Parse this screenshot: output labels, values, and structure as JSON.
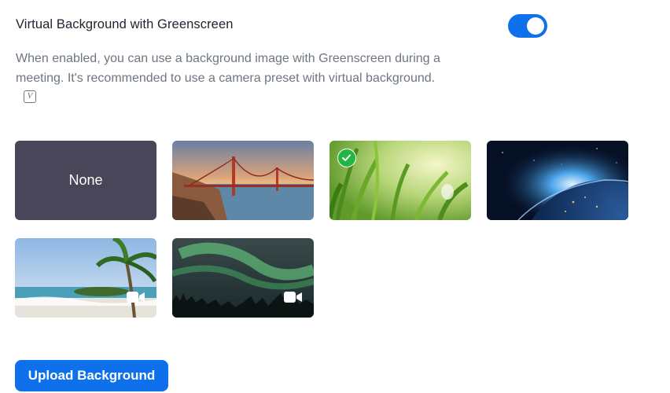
{
  "setting": {
    "title": "Virtual Background with Greenscreen",
    "enabled": true,
    "description": "When enabled, you can use a background image with Greenscreen during a meeting. It's recommended to use a camera preset with virtual background.",
    "vendor_logo_letter": "V"
  },
  "backgrounds": [
    {
      "label": "None",
      "type": "none",
      "selected": false
    },
    {
      "scene": "golden-gate-bridge",
      "type": "image",
      "selected": false
    },
    {
      "scene": "grass",
      "type": "image",
      "selected": true
    },
    {
      "scene": "earth-from-space",
      "type": "image",
      "selected": false
    },
    {
      "scene": "beach-palm",
      "type": "video",
      "selected": false
    },
    {
      "scene": "aurora",
      "type": "video",
      "selected": false
    }
  ],
  "upload": {
    "label": "Upload Background"
  },
  "colors": {
    "accent": "#0e71eb",
    "selected_check": "#23b541",
    "none_tile": "#494659"
  }
}
